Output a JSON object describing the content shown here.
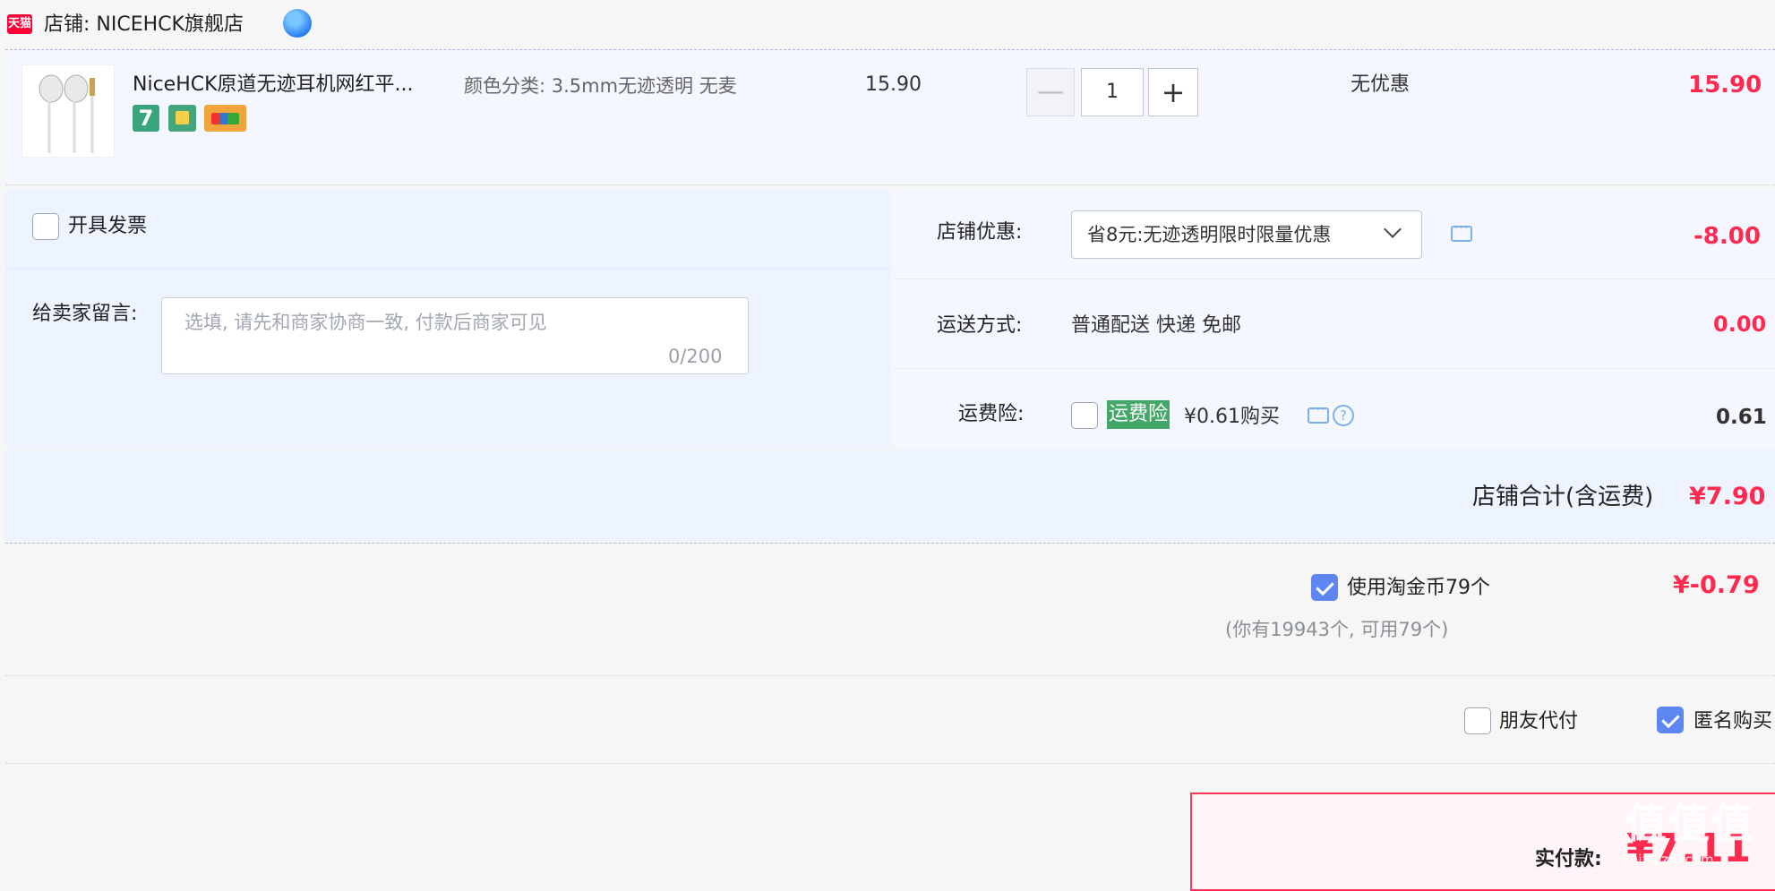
{
  "shop": {
    "brand": "天猫",
    "name": "店铺: NICEHCK旗舰店"
  },
  "item": {
    "title": "NiceHCK原道无迹耳机网红平...",
    "sku": "颜色分类: 3.5mm无迹透明 无麦",
    "unit_price": "15.90",
    "quantity": "1",
    "minus": "—",
    "plus": "+",
    "discount": "无优惠",
    "total": "15.90",
    "badges": [
      "7"
    ]
  },
  "invoice": {
    "label": "开具发票"
  },
  "message": {
    "label": "给卖家留言:",
    "placeholder": "选填, 请先和商家协商一致, 付款后商家可见",
    "count": "0/200"
  },
  "coupon": {
    "label": "店铺优惠:",
    "value": "省8元:无迹透明限时限量优惠",
    "amount": "-8.00"
  },
  "shipping": {
    "label": "运送方式:",
    "value": "普通配送 快递 免邮",
    "amount": "0.00"
  },
  "insurance": {
    "label": "运费险:",
    "tag": "运费险",
    "price": "¥0.61购买",
    "amount": "0.61"
  },
  "store_total": {
    "label": "店铺合计(含运费)",
    "amount": "¥7.90"
  },
  "coins": {
    "label": "使用淘金币79个",
    "amount": "¥-0.79",
    "note": "(你有19943个, 可用79个)"
  },
  "options": {
    "friend_pay": "朋友代付",
    "anonymous": "匿名购买"
  },
  "payment": {
    "label": "实付款:",
    "amount": "¥7.11"
  },
  "watermark": {
    "main": "值值值",
    "sub": "zhizhizhi.com"
  },
  "colors": {
    "accent_red": "#ff2a4f",
    "check_blue": "#5d86f2",
    "insurance_green": "#42a868"
  }
}
